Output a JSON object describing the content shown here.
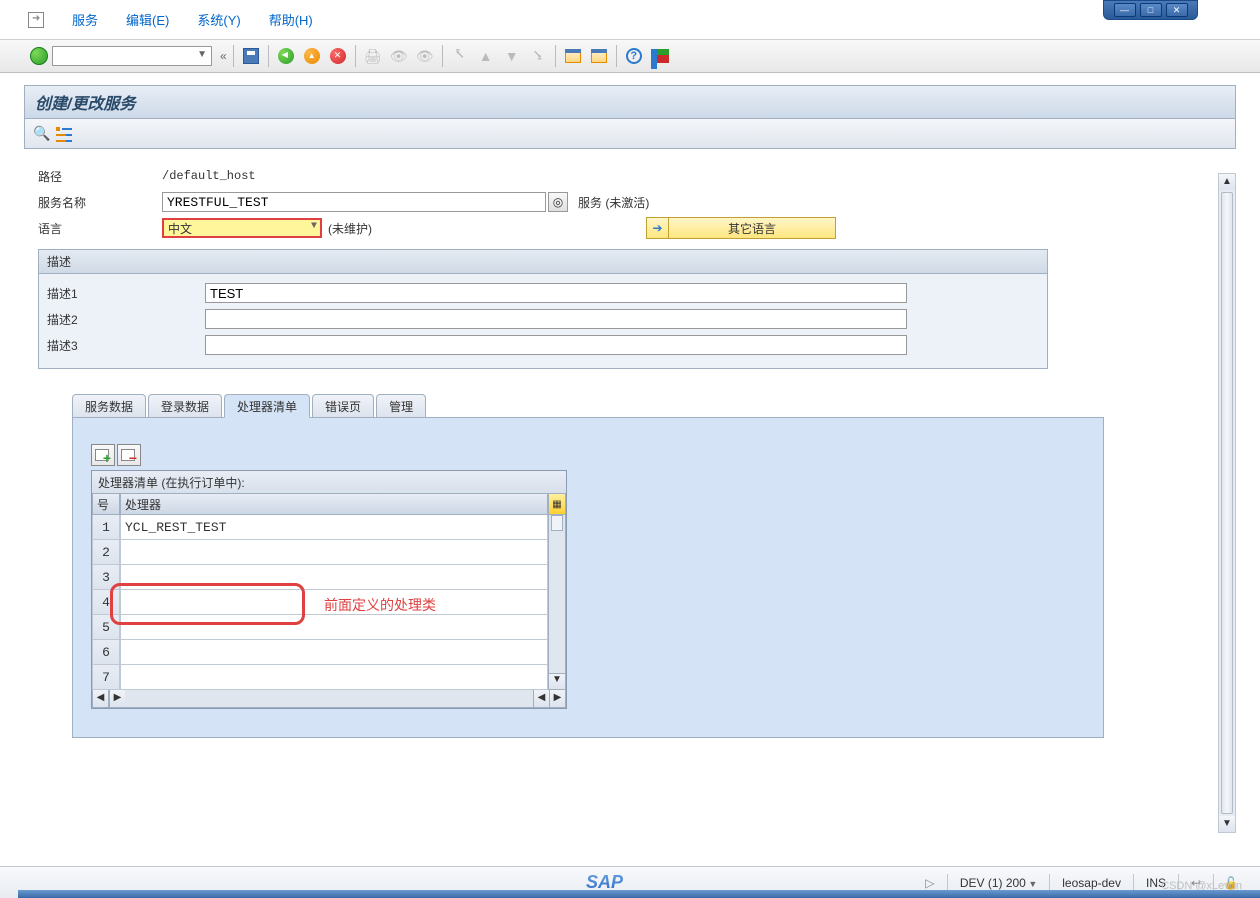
{
  "menu": {
    "service": "服务",
    "edit": "编辑(E)",
    "system": "系统(Y)",
    "help": "帮助(H)"
  },
  "page_title": "创建/更改服务",
  "form": {
    "path_label": "路径",
    "path_value": "/default_host",
    "service_label": "服务名称",
    "service_value": "YRESTFUL_TEST",
    "service_status": "服务 (未激活)",
    "lang_label": "语言",
    "lang_value": "中文",
    "lang_note": "(未维护)",
    "other_lang_btn": "其它语言"
  },
  "desc_group": {
    "title": "描述",
    "d1_label": "描述1",
    "d1_value": "TEST",
    "d2_label": "描述2",
    "d2_value": "",
    "d3_label": "描述3",
    "d3_value": ""
  },
  "tabs": [
    "服务数据",
    "登录数据",
    "处理器清单",
    "错误页",
    "管理"
  ],
  "active_tab": 2,
  "table": {
    "title": "处理器清单 (在执行订单中):",
    "col_num": "号",
    "col_proc": "处理器",
    "rows": [
      {
        "n": "1",
        "v": "YCL_REST_TEST"
      },
      {
        "n": "2",
        "v": ""
      },
      {
        "n": "3",
        "v": ""
      },
      {
        "n": "4",
        "v": ""
      },
      {
        "n": "5",
        "v": ""
      },
      {
        "n": "6",
        "v": ""
      },
      {
        "n": "7",
        "v": ""
      }
    ]
  },
  "annotation": "前面定义的处理类",
  "status": {
    "system": "DEV (1) 200",
    "host": "leosap-dev",
    "mode": "INS"
  },
  "watermark": "CSDN @xLevon"
}
